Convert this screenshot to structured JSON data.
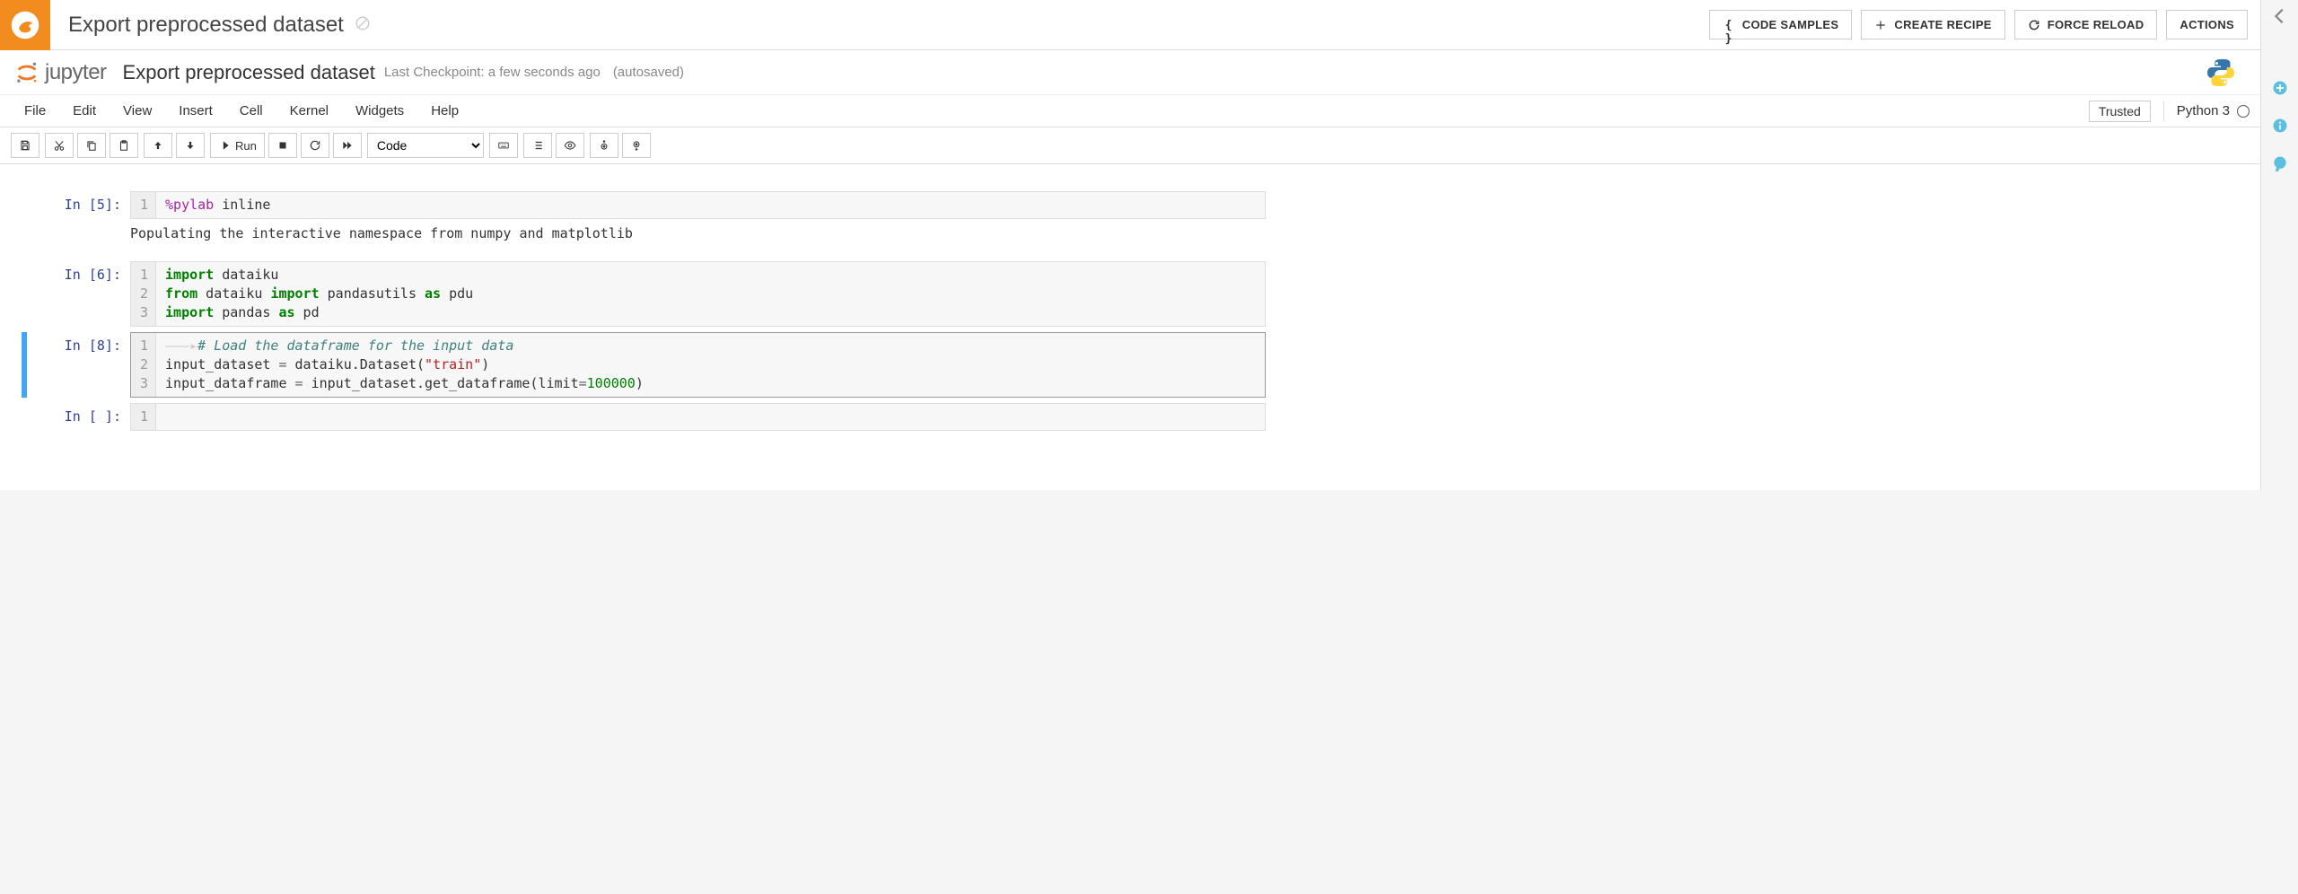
{
  "header": {
    "title": "Export preprocessed dataset",
    "buttons": {
      "code_samples": "CODE SAMPLES",
      "create_recipe": "CREATE RECIPE",
      "force_reload": "FORCE RELOAD",
      "actions": "ACTIONS"
    }
  },
  "jupyter": {
    "word": "jupyter",
    "title": "Export preprocessed dataset",
    "checkpoint": "Last Checkpoint: a few seconds ago",
    "autosaved": "(autosaved)"
  },
  "menu": {
    "file": "File",
    "edit": "Edit",
    "view": "View",
    "insert": "Insert",
    "cell": "Cell",
    "kernel": "Kernel",
    "widgets": "Widgets",
    "help": "Help",
    "trusted": "Trusted",
    "kernel_name": "Python 3"
  },
  "toolbar": {
    "run": "Run",
    "celltype": "Code"
  },
  "cells": [
    {
      "prompt": "In [5]:",
      "lines": [
        "1"
      ],
      "code_html": "<span class='tok-magic'>%pylab</span> inline",
      "output": "Populating the interactive namespace from numpy and matplotlib",
      "selected": false
    },
    {
      "prompt": "In [6]:",
      "lines": [
        "1",
        "2",
        "3"
      ],
      "code_html": "<span class='tok-kw'>import</span> dataiku\n<span class='tok-kw'>from</span> dataiku <span class='tok-kw'>import</span> pandasutils <span class='tok-kw'>as</span> pdu\n<span class='tok-kw'>import</span> pandas <span class='tok-kw'>as</span> pd",
      "output": null,
      "selected": false
    },
    {
      "prompt": "In [8]:",
      "lines": [
        "1",
        "2",
        "3"
      ],
      "code_html": "<span class='indent-guide'>———▸</span><span class='tok-comm'># Load the dataframe for the input data</span>\ninput_dataset <span class='tok-op'>=</span> dataiku.Dataset(<span class='tok-str'>\"train\"</span>)\ninput_dataframe <span class='tok-op'>=</span> input_dataset.get_dataframe(limit<span class='tok-op'>=</span><span class='tok-num'>100000</span>)",
      "output": null,
      "selected": true
    },
    {
      "prompt": "In [ ]:",
      "lines": [
        "1"
      ],
      "code_html": "",
      "output": null,
      "selected": false
    }
  ]
}
